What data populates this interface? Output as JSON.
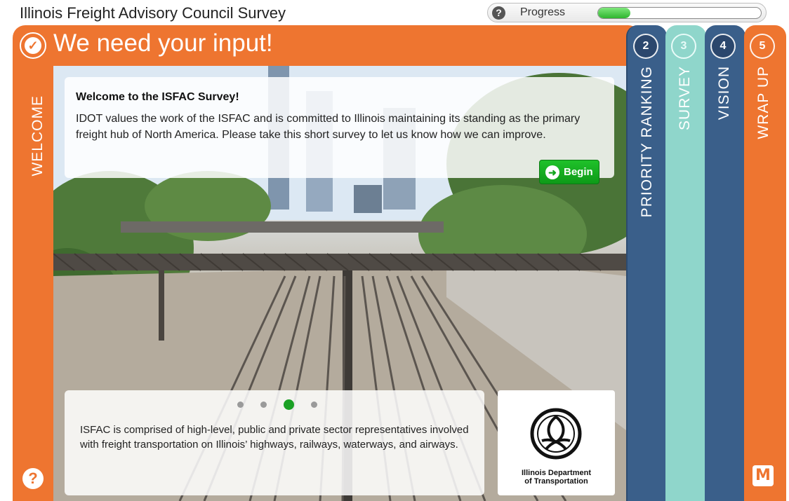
{
  "app": {
    "title": "Illinois Freight Advisory Council Survey"
  },
  "progress": {
    "label": "Progress",
    "help_icon": "help-icon",
    "value": 0.2
  },
  "welcome_panel": {
    "step_icon": "check-icon",
    "headline": "We need your input!",
    "side_label": "WELCOME",
    "help_icon": "help-icon"
  },
  "welcome_card": {
    "title": "Welcome to the ISFAC Survey!",
    "body": "IDOT values the work of the ISFAC and is committed to Illinois maintaining its standing as the primary freight hub of North America. Please take this short survey to let us know how we can improve.",
    "begin_label": "Begin",
    "begin_icon": "arrow-right-circle-icon"
  },
  "carousel": {
    "slide_count": 4,
    "active_index": 2,
    "text": "ISFAC is comprised of high-level, public and private sector representatives involved with freight transportation on Illinois’ highways, railways, waterways, and airways."
  },
  "logo": {
    "line1": "Illinois Department",
    "line2": "of Transportation"
  },
  "tabs": [
    {
      "number": "2",
      "label": "PRIORITY RANKING",
      "color": "#3a5f8a"
    },
    {
      "number": "3",
      "label": "SURVEY",
      "color": "#8fd6cb"
    },
    {
      "number": "4",
      "label": "VISION",
      "color": "#3a5f8a"
    },
    {
      "number": "5",
      "label": "WRAP UP",
      "color": "#ee7530"
    }
  ],
  "colors": {
    "accent": "#ee7530",
    "navy": "#3a5f8a",
    "teal": "#8fd6cb",
    "green": "#1aa024"
  },
  "brand_icon": "metroquest-logo-icon"
}
